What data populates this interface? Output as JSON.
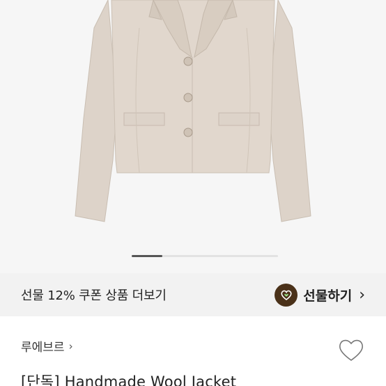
{
  "product": {
    "image_icon": "jacket-photo",
    "brand": "루에브르",
    "title": "[단독]  Handmade Wool Jacket"
  },
  "carousel": {
    "total": 5,
    "current": 1
  },
  "promo": {
    "coupon_text": "선물 12% 쿠폰 상품 더보기",
    "gift_label": "선물하기",
    "gift_icon": "gift-heart-icon",
    "accent": "#4a3119"
  },
  "icons": {
    "brand_chevron": "›",
    "gift_chevron": "›"
  },
  "wishlist": {
    "icon": "heart-outline-icon"
  }
}
